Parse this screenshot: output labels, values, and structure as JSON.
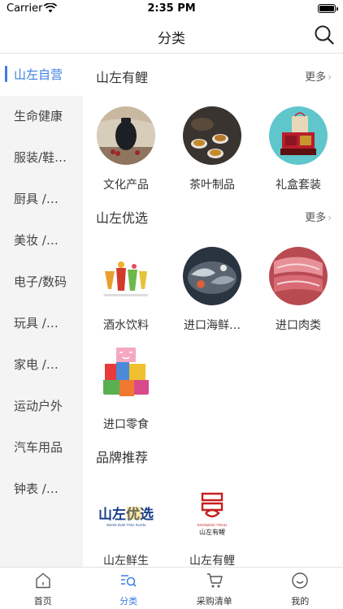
{
  "status_bar": {
    "carrier": "Carrier",
    "time": "2:35 PM",
    "battery_level": 1.0
  },
  "nav": {
    "title": "分类"
  },
  "sidebar": {
    "items": [
      {
        "label": "山左自营",
        "active": true
      },
      {
        "label": "生命健康",
        "active": false
      },
      {
        "label": "服装/鞋…",
        "active": false
      },
      {
        "label": "厨具 /…",
        "active": false
      },
      {
        "label": "美妆 /…",
        "active": false
      },
      {
        "label": "电子/数码",
        "active": false
      },
      {
        "label": "玩具 /…",
        "active": false
      },
      {
        "label": "家电 /…",
        "active": false
      },
      {
        "label": "运动户外",
        "active": false
      },
      {
        "label": "汽车用品",
        "active": false
      },
      {
        "label": "钟表 /…",
        "active": false
      }
    ]
  },
  "sections": [
    {
      "title": "山左有鲤",
      "more": "更多",
      "items": [
        {
          "label": "文化产品",
          "image": "black-ceramic-jar"
        },
        {
          "label": "茶叶制品",
          "image": "tea-cups"
        },
        {
          "label": "礼盒套装",
          "image": "gift-box-set"
        }
      ]
    },
    {
      "title": "山左优选",
      "more": "更多",
      "items": [
        {
          "label": "酒水饮料",
          "image": "cocktail-drinks"
        },
        {
          "label": "进口海鲜…",
          "image": "seafood"
        },
        {
          "label": "进口肉类",
          "image": "raw-meat"
        },
        {
          "label": "进口零食",
          "image": "snacks-pile"
        }
      ]
    },
    {
      "title": "品牌推荐",
      "brands": [
        {
          "label": "山左鲜生",
          "logo_text": "山左优选",
          "logo_sub": "SHAN ZUO YOU XUAN"
        },
        {
          "label": "山左有鲤",
          "logo_text": "山左有鲤",
          "logo_sub": "SHANZUO YOULI"
        }
      ]
    }
  ],
  "tabs": [
    {
      "label": "首页",
      "icon": "home-icon",
      "active": false
    },
    {
      "label": "分类",
      "icon": "category-search-icon",
      "active": true
    },
    {
      "label": "采购清单",
      "icon": "cart-icon",
      "active": false
    },
    {
      "label": "我的",
      "icon": "smiley-icon",
      "active": false
    }
  ],
  "colors": {
    "accent": "#3b7ee0",
    "sidebar_bg": "#f4f4f4",
    "text": "#333333"
  }
}
